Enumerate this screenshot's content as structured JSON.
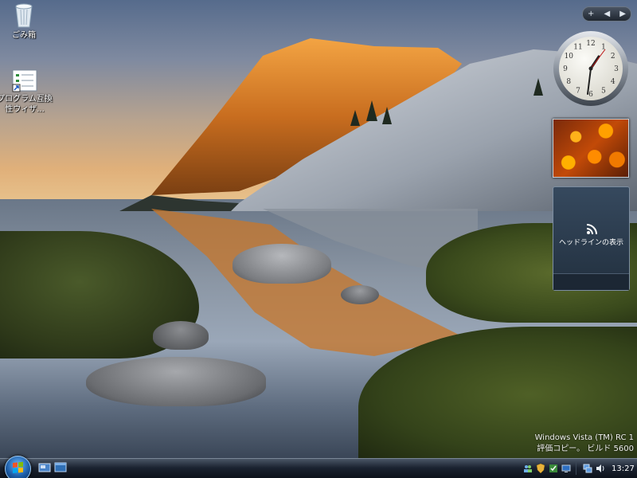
{
  "desktop": {
    "icons": [
      {
        "label": "ごみ箱"
      },
      {
        "label": "プログラム互換性ウィザ..."
      }
    ]
  },
  "sidebar": {
    "controls": {
      "add": "+",
      "prev": "◀",
      "next": "▶"
    },
    "feed": {
      "label": "ヘッドラインの表示"
    },
    "clock": {
      "hour_numbers": [
        "12",
        "1",
        "2",
        "3",
        "4",
        "5",
        "6",
        "7",
        "8",
        "9",
        "10",
        "11"
      ]
    }
  },
  "watermark": {
    "line1": "Windows Vista (TM) RC 1",
    "line2": "評価コピー。 ビルド 5600"
  },
  "taskbar": {
    "time": "13:27"
  },
  "colors": {
    "taskbar_bg": "#111822",
    "start_orb": "#1d5ea8",
    "feed_bg": "#2b3a4c"
  }
}
